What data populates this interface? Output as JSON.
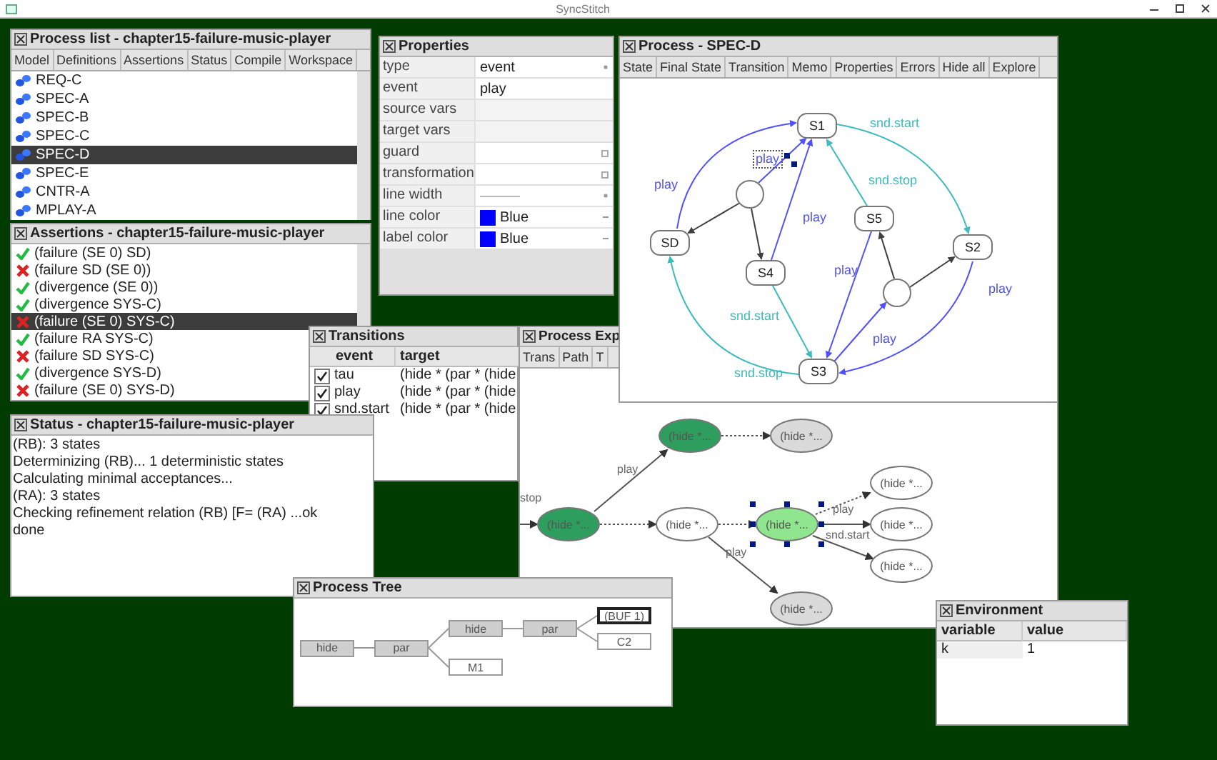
{
  "app": {
    "title": "SyncStitch"
  },
  "process_list": {
    "title": "Process list - chapter15-failure-music-player",
    "tabs": [
      {
        "label": "Model",
        "selected": false
      },
      {
        "label": "Definitions",
        "selected": false
      },
      {
        "label": "Assertions",
        "selected": false
      },
      {
        "label": "Status",
        "selected": false
      },
      {
        "label": "Compile",
        "selected": false
      },
      {
        "label": "Workspace",
        "selected": false
      }
    ],
    "items": [
      {
        "label": "REQ-C",
        "selected": false
      },
      {
        "label": "SPEC-A",
        "selected": false
      },
      {
        "label": "SPEC-B",
        "selected": false
      },
      {
        "label": "SPEC-C",
        "selected": false
      },
      {
        "label": "SPEC-D",
        "selected": true
      },
      {
        "label": "SPEC-E",
        "selected": false
      },
      {
        "label": "CNTR-A",
        "selected": false
      },
      {
        "label": "MPLAY-A",
        "selected": false
      }
    ]
  },
  "assertions": {
    "title": "Assertions - chapter15-failure-music-player",
    "items": [
      {
        "label": "(failure (SE 0) SD)",
        "passed": true,
        "selected": false
      },
      {
        "label": "(failure SD (SE 0))",
        "passed": false,
        "selected": false
      },
      {
        "label": "(divergence (SE 0))",
        "passed": true,
        "selected": false
      },
      {
        "label": "(divergence SYS-C)",
        "passed": true,
        "selected": false
      },
      {
        "label": "(failure (SE 0) SYS-C)",
        "passed": false,
        "selected": true
      },
      {
        "label": "(failure RA SYS-C)",
        "passed": true,
        "selected": false
      },
      {
        "label": "(failure SD SYS-C)",
        "passed": false,
        "selected": false
      },
      {
        "label": "(divergence SYS-D)",
        "passed": true,
        "selected": false
      },
      {
        "label": "(failure (SE 0) SYS-D)",
        "passed": false,
        "selected": false
      }
    ]
  },
  "properties": {
    "title": "Properties",
    "rows": [
      {
        "label": "type",
        "value": "event",
        "kind": "choice"
      },
      {
        "label": "event",
        "value": "play",
        "kind": "text"
      },
      {
        "label": "source vars",
        "kind": "readonly"
      },
      {
        "label": "target vars",
        "kind": "readonly"
      },
      {
        "label": "guard",
        "kind": "expr"
      },
      {
        "label": "transformation",
        "kind": "expr"
      },
      {
        "label": "line width",
        "kind": "line"
      },
      {
        "label": "line color",
        "value": "Blue",
        "kind": "color",
        "color": "#0000ff"
      },
      {
        "label": "label color",
        "value": "Blue",
        "kind": "color",
        "color": "#0000ff"
      }
    ]
  },
  "transitions": {
    "title": "Transitions",
    "columns": [
      "event",
      "target"
    ],
    "rows": [
      {
        "checked": true,
        "event": "tau",
        "target": "(hide * (par * (hide"
      },
      {
        "checked": true,
        "event": "play",
        "target": "(hide * (par * (hide"
      },
      {
        "checked": true,
        "event": "snd.start",
        "target": "(hide * (par * (hide"
      }
    ]
  },
  "status": {
    "title": "Status - chapter15-failure-music-player",
    "lines": [
      "(RB): 3 states",
      "Determinizing (RB)... 1 deterministic states",
      "Calculating minimal acceptances...",
      "(RA): 3 states",
      "Checking refinement relation (RB) [F= (RA) ...ok",
      "done"
    ]
  },
  "explorer": {
    "title": "Process Exp",
    "tabs": [
      {
        "label": "Trans",
        "selected": false
      },
      {
        "label": "Path",
        "selected": false
      },
      {
        "label": "T",
        "selected": false
      }
    ],
    "nodes": [
      {
        "label": "(hide *...",
        "color": "#2e9e5e",
        "selected": false
      },
      {
        "label": "(hide *...",
        "color": "#2e9e5e",
        "selected": false
      },
      {
        "label": "(hide *...",
        "color": "#dadada",
        "selected": false
      },
      {
        "label": "(hide *...",
        "color": "#ffffff",
        "selected": false
      },
      {
        "label": "(hide *...",
        "color": "#8fe68f",
        "selected": true
      },
      {
        "label": "(hide *...",
        "color": "#ffffff",
        "selected": false
      },
      {
        "label": "(hide *...",
        "color": "#ffffff",
        "selected": false
      },
      {
        "label": "(hide *...",
        "color": "#ffffff",
        "selected": false
      },
      {
        "label": "(hide *...",
        "color": "#dadada",
        "selected": false
      }
    ],
    "edge_labels": [
      "stop",
      "play",
      "play",
      "play",
      "snd.start"
    ]
  },
  "process_view": {
    "title": "Process - SPEC-D",
    "toolbar": [
      "State",
      "Final State",
      "Transition",
      "Memo",
      "Properties",
      "Errors",
      "Hide all",
      "Explore"
    ],
    "states": [
      {
        "kind": "state",
        "label": "S1"
      },
      {
        "kind": "state",
        "label": "S2"
      },
      {
        "kind": "state",
        "label": "S3"
      },
      {
        "kind": "state",
        "label": "S4"
      },
      {
        "kind": "state",
        "label": "S5"
      },
      {
        "kind": "state",
        "label": "SD"
      },
      {
        "kind": "junction"
      },
      {
        "kind": "junction"
      }
    ],
    "transitions": [
      {
        "label": "play",
        "color": "#5050ff",
        "selected": false
      },
      {
        "label": "play",
        "color": "#5050ff",
        "selected": true
      },
      {
        "color": "#404040",
        "selected": false
      },
      {
        "color": "#404040",
        "selected": false
      },
      {
        "label": "play",
        "color": "#5050ff",
        "selected": false
      },
      {
        "label": "snd.start",
        "color": "#3cbcbc",
        "selected": false
      },
      {
        "label": "snd.stop",
        "color": "#3cbcbc",
        "selected": false
      },
      {
        "label": "play",
        "color": "#5050ff",
        "selected": false
      },
      {
        "color": "#404040",
        "selected": false
      },
      {
        "color": "#404040",
        "selected": false
      },
      {
        "label": "play",
        "color": "#5050ff",
        "selected": false
      },
      {
        "label": "play",
        "color": "#5050ff",
        "selected": false
      },
      {
        "label": "snd.start",
        "color": "#3cbcbc",
        "selected": false
      },
      {
        "label": "snd.stop",
        "color": "#3cbcbc",
        "selected": false
      }
    ]
  },
  "process_tree": {
    "title": "Process Tree",
    "root": {
      "label": "hide",
      "kind": "operator",
      "selected": false,
      "children": [
        {
          "label": "par",
          "kind": "operator",
          "selected": false,
          "children": [
            {
              "label": "hide",
              "kind": "operator",
              "selected": false,
              "children": [
                {
                  "label": "par",
                  "kind": "operator",
                  "selected": false,
                  "children": [
                    {
                      "label": "(BUF 1)",
                      "kind": "process",
                      "selected": true
                    },
                    {
                      "label": "C2",
                      "kind": "process",
                      "selected": false
                    }
                  ]
                }
              ]
            },
            {
              "label": "M1",
              "kind": "process",
              "selected": false
            }
          ]
        }
      ]
    }
  },
  "environment": {
    "title": "Environment",
    "columns": [
      "variable",
      "value"
    ],
    "rows": [
      [
        "k",
        "1"
      ]
    ]
  }
}
